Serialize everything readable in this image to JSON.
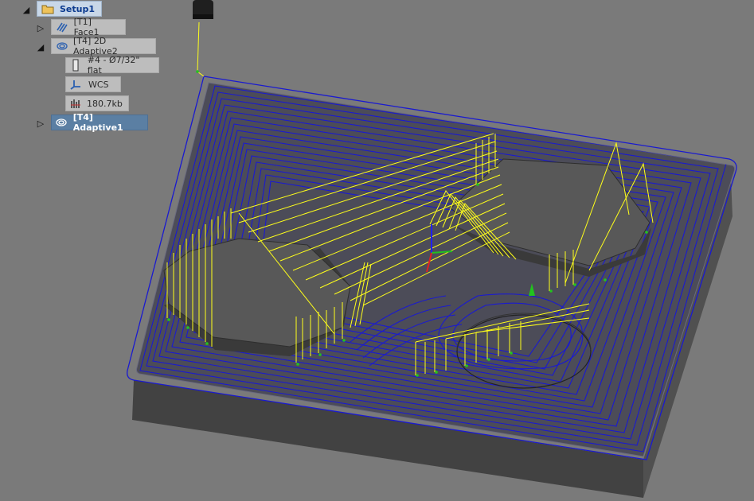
{
  "browser": {
    "setup": {
      "label": "Setup1",
      "expanded": true,
      "icon": "setup-folder-icon"
    },
    "operations": [
      {
        "label": "[T1] Face1",
        "expanded": false,
        "icon": "face-operation-icon"
      },
      {
        "label": "[T4] 2D Adaptive2",
        "expanded": true,
        "icon": "adaptive-operation-icon",
        "children": [
          {
            "label": "#4 - Ø7/32\" flat",
            "icon": "tool-icon"
          },
          {
            "label": "WCS",
            "icon": "wcs-axes-icon"
          },
          {
            "label": "180.7kb",
            "icon": "toolpath-size-icon"
          }
        ]
      },
      {
        "label": "[T4] Adaptive1",
        "expanded": false,
        "selected": true,
        "icon": "adaptive-operation-icon"
      }
    ]
  },
  "colors": {
    "background": "#7a7a7a",
    "stock_top": "#4c4c58",
    "stock_side": "#404040",
    "hex_top": "#585858",
    "toolpath_cut": "#1a1ad0",
    "toolpath_link": "#ffff1a",
    "entry_marks": "#22c31e",
    "selected_item": "#5b7fa3"
  }
}
